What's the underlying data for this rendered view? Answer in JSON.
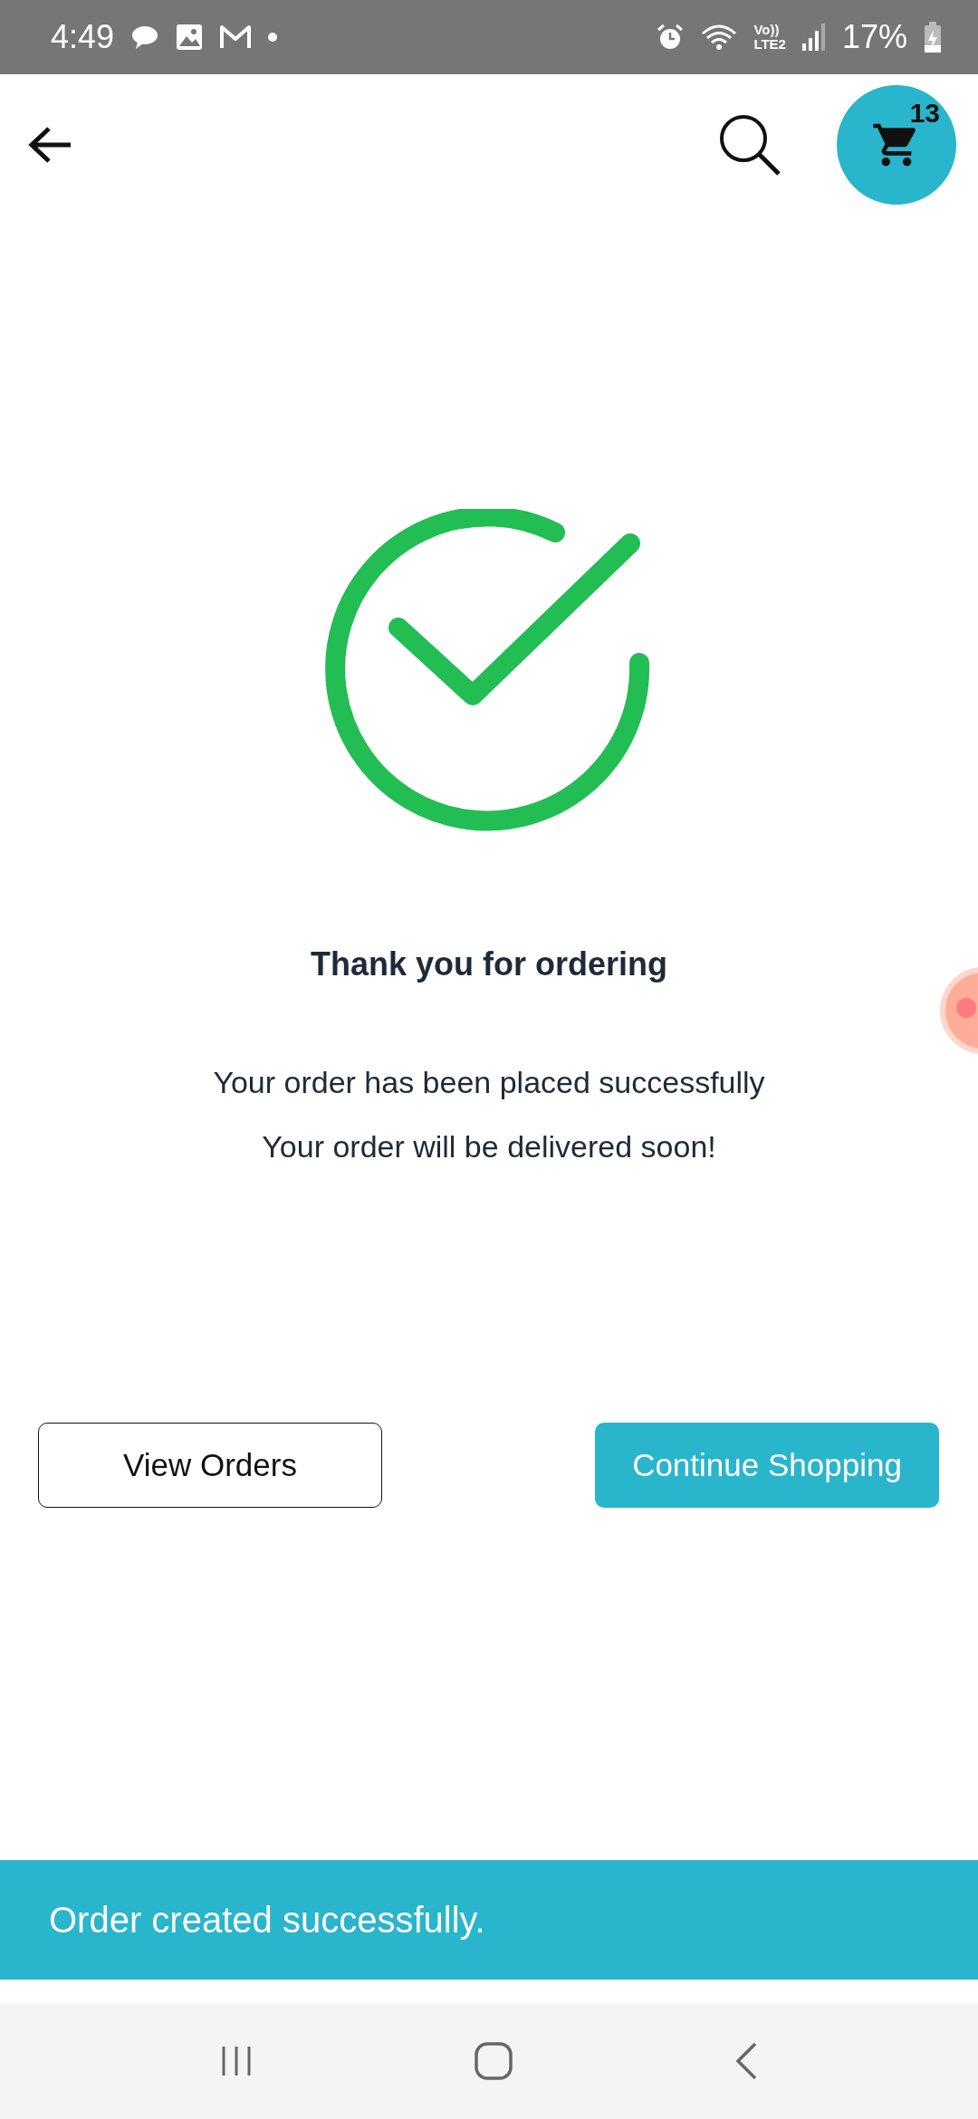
{
  "status_bar": {
    "time": "4:49",
    "network": [
      "Vo))",
      "LTE2"
    ],
    "battery": "17%"
  },
  "header": {
    "cart_count": "13"
  },
  "confirmation": {
    "title": "Thank you for ordering",
    "lines": [
      "Your order has been placed successfully",
      "Your order will be delivered soon!"
    ]
  },
  "buttons": [
    {
      "label": "View Orders",
      "kind": "outline"
    },
    {
      "label": "Continue Shopping",
      "kind": "filled"
    }
  ],
  "snackbar": {
    "message": "Order created successfully."
  }
}
